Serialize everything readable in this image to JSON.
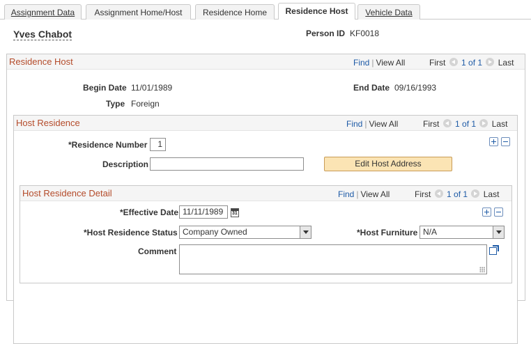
{
  "tabs": [
    {
      "label": "Assignment Data",
      "active": false
    },
    {
      "label": "Assignment Home/Host",
      "active": false
    },
    {
      "label": "Residence Home",
      "active": false
    },
    {
      "label": "Residence Host",
      "active": true
    },
    {
      "label": "Vehicle Data",
      "active": false
    }
  ],
  "header": {
    "person_name": "Yves Chabot",
    "person_id_label": "Person ID",
    "person_id": "KF0018"
  },
  "residence_host": {
    "title": "Residence Host",
    "nav": {
      "find": "Find",
      "sep": "|",
      "view_all": "View All",
      "first": "First",
      "count": "1 of 1",
      "last": "Last"
    },
    "begin_date_label": "Begin Date",
    "begin_date": "11/01/1989",
    "end_date_label": "End Date",
    "end_date": "09/16/1993",
    "type_label": "Type",
    "type": "Foreign"
  },
  "host_residence": {
    "title": "Host Residence",
    "nav": {
      "find": "Find",
      "sep": "|",
      "view_all": "View All",
      "first": "First",
      "count": "1 of 1",
      "last": "Last"
    },
    "residence_number_label": "*Residence Number",
    "residence_number": "1",
    "description_label": "Description",
    "description": "",
    "edit_button": "Edit Host Address"
  },
  "host_residence_detail": {
    "title": "Host Residence Detail",
    "nav": {
      "find": "Find",
      "sep": "|",
      "view_all": "View All",
      "first": "First",
      "count": "1 of 1",
      "last": "Last"
    },
    "effective_date_label": "*Effective Date",
    "effective_date": "11/11/1989",
    "calendar_glyph": "31",
    "status_label": "*Host Residence Status",
    "status_value": "Company Owned",
    "furniture_label": "*Host Furniture",
    "furniture_value": "N/A",
    "comment_label": "Comment",
    "comment": ""
  },
  "icons": {
    "nav_prev": "chevron-left-icon",
    "nav_next": "chevron-right-icon",
    "add_row": "plus-icon",
    "delete_row": "minus-icon",
    "calendar": "calendar-icon",
    "expand": "expand-icon"
  },
  "colors": {
    "section_title": "#b44b2a",
    "link": "#1d5aa6",
    "button_bg": "#fbe4b4"
  }
}
